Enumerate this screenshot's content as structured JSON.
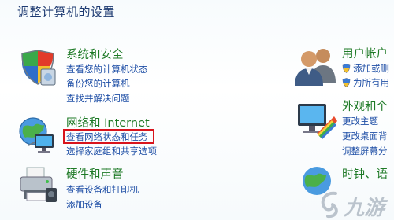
{
  "page": {
    "title": "调整计算机的设置"
  },
  "categories": {
    "system": {
      "heading": "系统和安全",
      "links": [
        "查看您的计算机状态",
        "备份您的计算机",
        "查找并解决问题"
      ]
    },
    "network": {
      "heading": "网络和 Internet",
      "links": [
        "查看网络状态和任务",
        "选择家庭组和共享选项"
      ]
    },
    "hardware": {
      "heading": "硬件和声音",
      "links": [
        "查看设备和打印机",
        "添加设备"
      ]
    },
    "users": {
      "heading": "用户帐户",
      "links": [
        "添加或删",
        "为所有用"
      ]
    },
    "appearance": {
      "heading": "外观和个",
      "links": [
        "更改主题",
        "更改桌面背",
        "调整屏幕分"
      ]
    },
    "clock": {
      "heading": "时钟、语"
    }
  },
  "highlighted_link": "查看网络状态和任务",
  "watermark": {
    "text": "九游"
  },
  "icons": {
    "system": "shield-icon",
    "network": "network-globe-icon",
    "hardware": "printer-icon",
    "users": "users-icon",
    "appearance": "monitor-palette-icon",
    "clock": "globe-clock-icon",
    "uac": "uac-shield-icon"
  },
  "colors": {
    "heading": "#1e7a26",
    "link": "#1f4fa6",
    "title": "#1e3b72",
    "highlight": "#d8141c"
  }
}
